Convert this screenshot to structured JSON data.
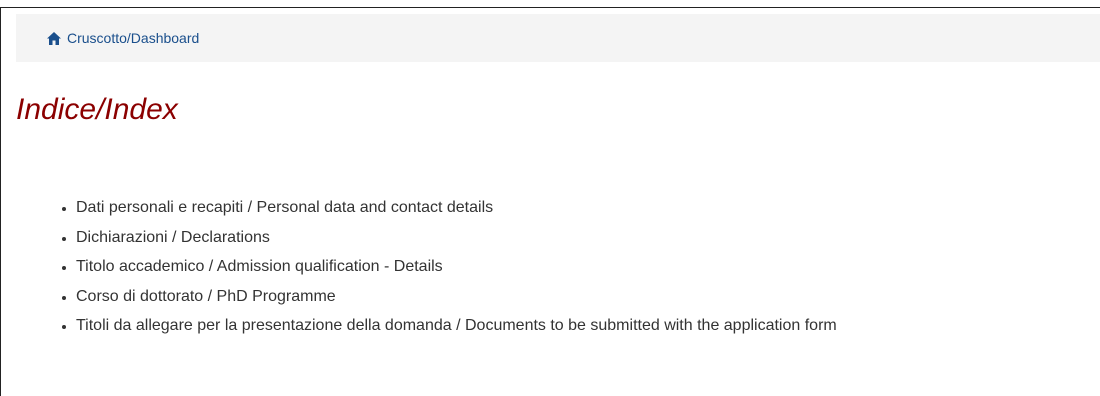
{
  "breadcrumb": {
    "icon": "home-icon",
    "label": "Cruscotto/Dashboard"
  },
  "page": {
    "title": "Indice/Index"
  },
  "index": {
    "items": [
      "Dati personali e recapiti / Personal data and contact details",
      "Dichiarazioni / Declarations",
      "Titolo accademico / Admission qualification - Details",
      "Corso di dottorato / PhD Programme",
      "Titoli da allegare per la presentazione della domanda / Documents to be submitted with the application form"
    ]
  },
  "colors": {
    "title": "#8b0000",
    "link": "#1a4f8c",
    "breadcrumb_bg": "#f4f4f4",
    "text": "#333333"
  }
}
